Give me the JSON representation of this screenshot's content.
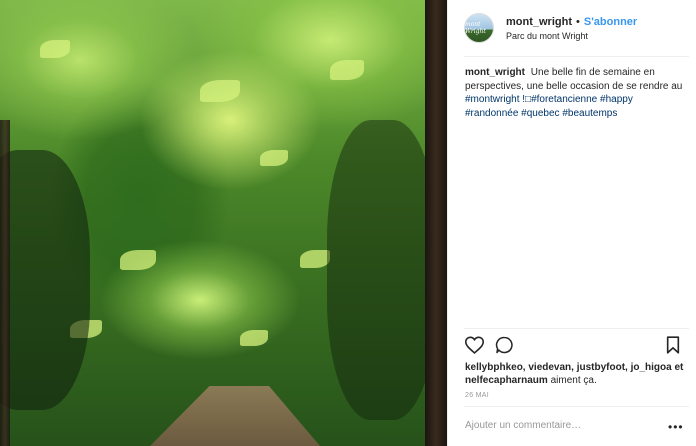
{
  "post": {
    "image_alt": "",
    "username": "mont_wright",
    "separator": "•",
    "follow_label": "S'abonner",
    "location": "Parc du mont Wright",
    "avatar_text": "mont Wright"
  },
  "caption": {
    "username": "mont_wright",
    "text": "Une belle fin de semaine en perspectives, une belle occasion de se rendre au",
    "tags": [
      "#montwright",
      "!□#foretancienne",
      "#happy",
      "#randonnée",
      "#quebec",
      "#beautemps"
    ]
  },
  "actions": {
    "like_icon": "heart-icon",
    "comment_icon": "comment-icon",
    "save_icon": "bookmark-icon"
  },
  "likes": {
    "names": "kellybphkeo, viedevan, justbyfoot, jo_higoa et nelfecapharnaum",
    "suffix": "aiment ça."
  },
  "date": "26 MAI",
  "comment": {
    "placeholder": "Ajouter un commentaire…",
    "more_label": "•••"
  }
}
